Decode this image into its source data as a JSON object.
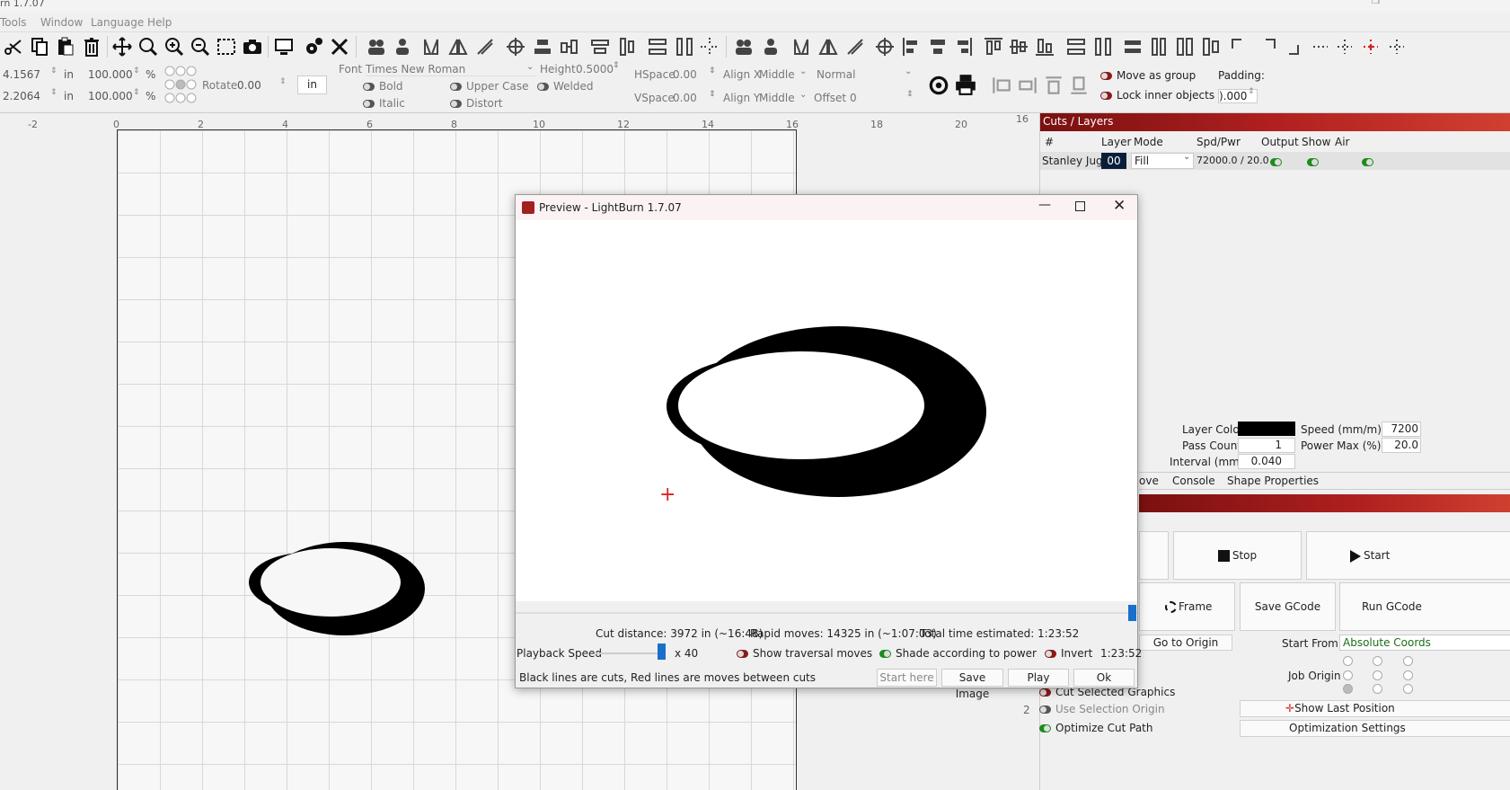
{
  "app": {
    "title": "rn 1.7.07"
  },
  "menu": {
    "items": [
      "Tools",
      "Window",
      "Language",
      "Help"
    ]
  },
  "props": {
    "x": "4.1567",
    "y": "2.2064",
    "unit1": "in",
    "unit2": "in",
    "w": "100.000",
    "h": "100.000",
    "pct1": "%",
    "pct2": "%",
    "rotate_label": "Rotate",
    "rotate": "0.00",
    "unit_btn": "in",
    "font_label": "Font",
    "font": "Times New Roman",
    "height_label": "Height",
    "height": "0.5000",
    "hspace_label": "HSpace",
    "hspace": "0.00",
    "vspace_label": "VSpace",
    "vspace": "0.00",
    "alignx_label": "Align X",
    "alignx": "Middle",
    "aligny_label": "Align Y",
    "aligny": "Middle",
    "normal": "Normal",
    "offset_label": "Offset",
    "offset": "0",
    "bold": "Bold",
    "italic": "Italic",
    "upper_case": "Upper Case",
    "distort": "Distort",
    "welded": "Welded",
    "move_as_group": "Move as group",
    "lock_inner": "Lock inner objects",
    "padding_label": "Padding:",
    "padding": ").000"
  },
  "ruler": {
    "labels": [
      "-2",
      "0",
      "2",
      "4",
      "6",
      "8",
      "10",
      "12",
      "14",
      "16",
      "18",
      "20"
    ],
    "right_label": "16"
  },
  "layers": {
    "title": "Cuts / Layers",
    "headers": [
      "#",
      "Layer",
      "Mode",
      "Spd/Pwr",
      "Output",
      "Show",
      "Air"
    ],
    "row": {
      "name": "Stanley Jugs",
      "layer": "00",
      "mode": "Fill",
      "spdpwr": "72000.0 / 20.0"
    }
  },
  "layer_props": {
    "layer_color_label": "Layer Color",
    "pass_count_label": "Pass Count",
    "pass_count": "1",
    "interval_label": "Interval (mm)",
    "interval": "0.040",
    "speed_label": "Speed (mm/m)",
    "speed": "7200",
    "power_label": "Power Max (%)",
    "power": "20.0",
    "layer_color": "#000000"
  },
  "tabs": {
    "move": "ove",
    "console": "Console",
    "shape": "Shape Properties"
  },
  "laser": {
    "stop": "Stop",
    "start": "Start",
    "frame": "Frame",
    "save_gcode": "Save GCode",
    "run_gcode": "Run GCode",
    "go_to_origin": "Go to Origin",
    "start_from_label": "Start From:",
    "start_from": "Absolute Coords",
    "job_origin": "Job Origin",
    "cut_selected": "Cut Selected Graphics",
    "use_selection": "Use Selection Origin",
    "optimize": "Optimize Cut Path",
    "show_last": "Show Last Position",
    "opt_settings": "Optimization Settings",
    "small_2": "2"
  },
  "preview": {
    "title": "Preview - LightBurn 1.7.07",
    "cut_distance": "Cut distance: 3972 in (~16:48)",
    "rapid_moves": "Rapid moves: 14325 in (~1:07:03)",
    "total_time": "Total time estimated: 1:23:52",
    "playback_label": "Playback Speed",
    "speed_mult": "x 40",
    "show_traversal": "Show traversal moves",
    "shade_power": "Shade according to power",
    "invert": "Invert",
    "time": "1:23:52",
    "legend": "Black lines are cuts, Red lines are moves between cuts",
    "start_here": "Start here",
    "save_image": "Save Image",
    "play": "Play",
    "ok": "Ok"
  }
}
